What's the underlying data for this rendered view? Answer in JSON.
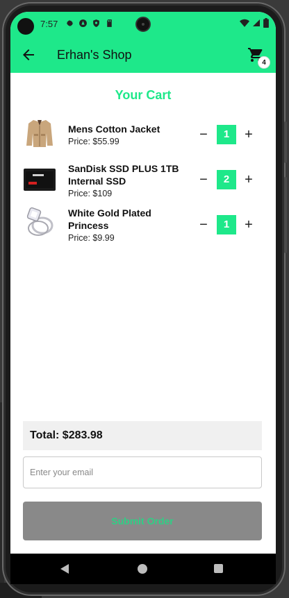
{
  "status_bar": {
    "time": "7:57",
    "icons": [
      "settings-icon",
      "vpn-icon",
      "shield-icon",
      "sd-card-icon"
    ],
    "right_icons": [
      "wifi-icon",
      "signal-icon",
      "battery-icon"
    ]
  },
  "app_bar": {
    "title": "Erhan's Shop",
    "back_icon": "arrow-left-icon",
    "cart_icon": "shopping-cart-icon",
    "cart_count": "4",
    "color": "#1ee88a"
  },
  "cart": {
    "heading": "Your Cart",
    "items": [
      {
        "name": "Mens Cotton Jacket",
        "price": "Price: $55.99",
        "quantity": "1",
        "image": "jacket-image"
      },
      {
        "name": "SanDisk SSD PLUS 1TB Internal SSD",
        "price": "Price: $109",
        "quantity": "2",
        "image": "ssd-image"
      },
      {
        "name": "White Gold Plated Princess",
        "price": "Price: $9.99",
        "quantity": "1",
        "image": "ring-image"
      }
    ],
    "minus_symbol": "−",
    "plus_symbol": "+"
  },
  "checkout": {
    "total": "Total: $283.98",
    "email_placeholder": "Enter your email",
    "email_value": "",
    "submit_label": "Submit Order"
  },
  "colors": {
    "accent": "#1ee88a",
    "submit_bg": "#898989",
    "submit_text": "#2fcf85"
  }
}
